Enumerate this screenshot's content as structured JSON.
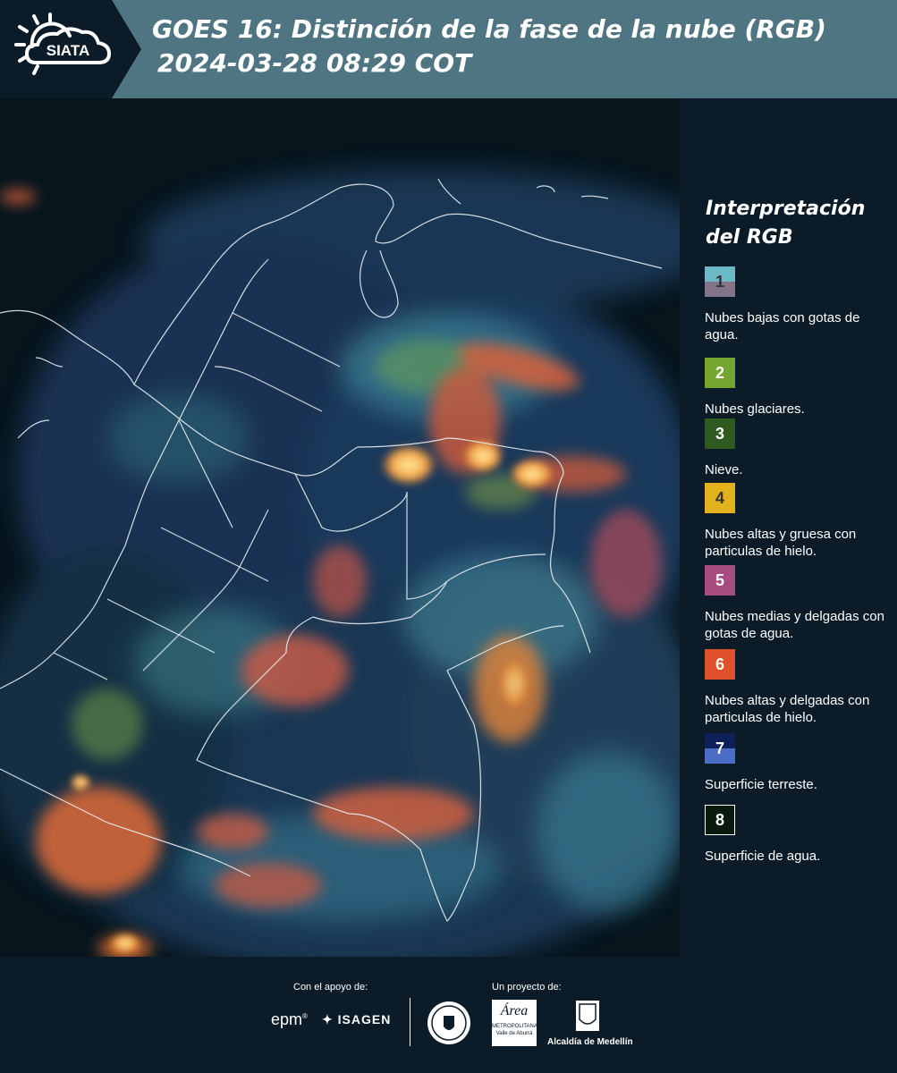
{
  "header": {
    "logo_text": "SIATA",
    "title_line1": "GOES 16: Distinción de la fase de la nube (RGB)",
    "title_line2": "2024-03-28 08:29 COT"
  },
  "legend": {
    "title_line1": "Interpretación",
    "title_line2": "del RGB",
    "items": [
      {
        "num": "1",
        "label": "Nubes bajas con gotas de agua.",
        "color_top": "#6bbac6",
        "color_bottom": "#827489",
        "num_color": "#333333"
      },
      {
        "num": "2",
        "label": "Nubes glaciares.",
        "color_top": "#74a52e",
        "color_bottom": "#74a52e",
        "num_color": "#ffffff"
      },
      {
        "num": "3",
        "label": "Nieve.",
        "color_top": "#2e5a20",
        "color_bottom": "#2e5a20",
        "num_color": "#ffffff"
      },
      {
        "num": "4",
        "label": "Nubes altas y gruesa con particulas de hielo.",
        "color_top": "#e2b21d",
        "color_bottom": "#e2b21d",
        "num_color": "#333333"
      },
      {
        "num": "5",
        "label": "Nubes medias y delgadas con gotas de agua.",
        "color_top": "#a64c80",
        "color_bottom": "#a64c80",
        "num_color": "#ffffff"
      },
      {
        "num": "6",
        "label": "Nubes altas y delgadas con particulas de hielo.",
        "color_top": "#e0502a",
        "color_bottom": "#e0502a",
        "num_color": "#ffffff"
      },
      {
        "num": "7",
        "label": "Superficie terreste.",
        "color_top": "#0e2057",
        "color_bottom": "#4a6ec6",
        "num_color": "#ffffff"
      },
      {
        "num": "8",
        "label": "Superficie de agua.",
        "color_top": "#0a1a0e",
        "color_bottom": "#0a1a0e",
        "num_color": "#ffffff"
      }
    ]
  },
  "footer": {
    "support_label": "Con el apoyo de:",
    "project_label": "Un proyecto de:",
    "epm_text": "epm",
    "isagen_text": "ISAGEN",
    "area_text": "Área",
    "area_sub": "METROPOLITANA",
    "area_sub2": "Valle de Aburrá",
    "alcaldia_text": "Alcaldía de Medellín"
  }
}
